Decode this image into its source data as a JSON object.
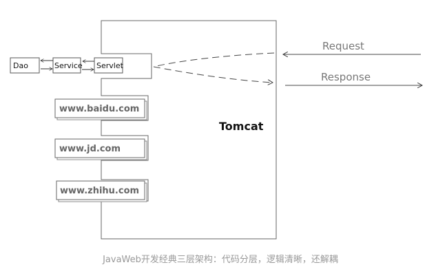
{
  "diagram": {
    "container_label": "Tomcat",
    "components": {
      "dao": "Dao",
      "service": "Service",
      "servlet": "Servlet"
    },
    "sites": [
      "www.baidu.com",
      "www.jd.com",
      "www.zhihu.com"
    ],
    "request_label": "Request",
    "response_label": "Response"
  },
  "caption": "JavaWeb开发经典三层架构：代码分层，逻辑清晰，还解耦"
}
